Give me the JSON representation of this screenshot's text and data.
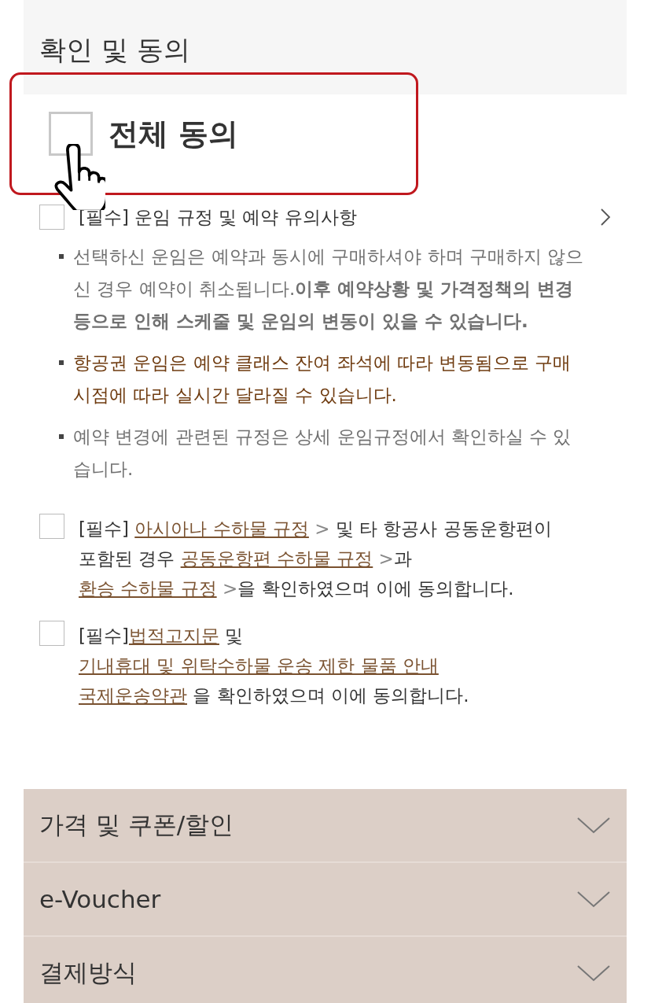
{
  "header": {
    "title": "확인 및 동의"
  },
  "all_agree": {
    "label": "전체 동의",
    "checked": false
  },
  "terms": [
    {
      "kind": "summary",
      "checked": false,
      "label": "[필수] 운임 규정 및 예약 유의사항",
      "notes": [
        {
          "text": "선택하신 운임은 예약과 동시에 구매하셔야 하며 구매하지 않으신 경우 예약이 취소됩니다.**이후 예약상황 및 가격정책의 변경 등으로 인해 스케줄 및 운임의 변동이 있을 수 있습니다.**",
          "color": "#707070"
        },
        {
          "text": "항공권 운임은 예약 클래스 잔여 좌석에 따라 변동됨으로 구매시점에 따라 실시간 달라질 수 있습니다.",
          "color": "#6e3a0e"
        },
        {
          "text": "예약 변경에 관련된 규정은 상세 운임규정에서 확인하실 수 있습니다.",
          "color": "#707070"
        }
      ]
    },
    {
      "kind": "links",
      "checked": false,
      "lines": [
        [
          {
            "kind": "plain",
            "text": "[필수] "
          },
          {
            "kind": "link",
            "text": "아시아나 수하물 규정"
          },
          {
            "kind": "arrow",
            "text": " > "
          },
          {
            "kind": "plain",
            "text": "및 타 항공사 공동운항편이"
          }
        ],
        [
          {
            "kind": "plain",
            "text": "포함된 경우 "
          },
          {
            "kind": "link",
            "text": "공동운항편 수하물 규정"
          },
          {
            "kind": "arrow",
            "text": " >"
          },
          {
            "kind": "plain",
            "text": "과"
          }
        ],
        [
          {
            "kind": "link",
            "text": "환승 수하물 규정"
          },
          {
            "kind": "arrow",
            "text": " >"
          },
          {
            "kind": "plain",
            "text": "을 확인하였으며 이에 동의합니다."
          }
        ]
      ]
    },
    {
      "kind": "links",
      "checked": false,
      "lines": [
        [
          {
            "kind": "plain",
            "text": "[필수]"
          },
          {
            "kind": "link",
            "text": "법적고지문"
          },
          {
            "kind": "plain",
            "text": " 및"
          }
        ],
        [
          {
            "kind": "link",
            "text": "기내휴대 및 위탁수하물 운송 제한 물품 안내"
          }
        ],
        [
          {
            "kind": "link",
            "text": "국제운송약관"
          },
          {
            "kind": "plain",
            "text": " 을 확인하였으며 이에 동의합니다."
          }
        ]
      ]
    }
  ],
  "sections": [
    {
      "title": "가격 및 쿠폰/할인",
      "expanded": false
    },
    {
      "title": "e-Voucher",
      "expanded": false
    },
    {
      "title": "결제방식",
      "expanded": false
    }
  ]
}
